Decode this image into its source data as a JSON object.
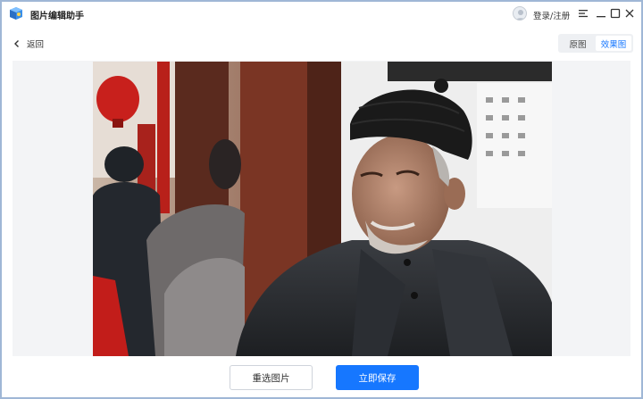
{
  "app": {
    "title": "图片编辑助手",
    "login_label": "登录/注册"
  },
  "toolbar": {
    "back_label": "返回",
    "view_tabs": [
      {
        "label": "原图",
        "active": false
      },
      {
        "label": "效果图",
        "active": true
      }
    ]
  },
  "actions": {
    "reselect_label": "重选图片",
    "save_label": "立即保存"
  },
  "colors": {
    "accent": "#1677ff",
    "window_border": "#9fb7d6"
  },
  "icons": {
    "app": "app-logo-icon",
    "back": "chevron-left-icon",
    "user": "user-avatar-icon",
    "menu": "menu-icon",
    "minimize": "minimize-icon",
    "maximize": "maximize-icon",
    "close": "close-icon"
  }
}
